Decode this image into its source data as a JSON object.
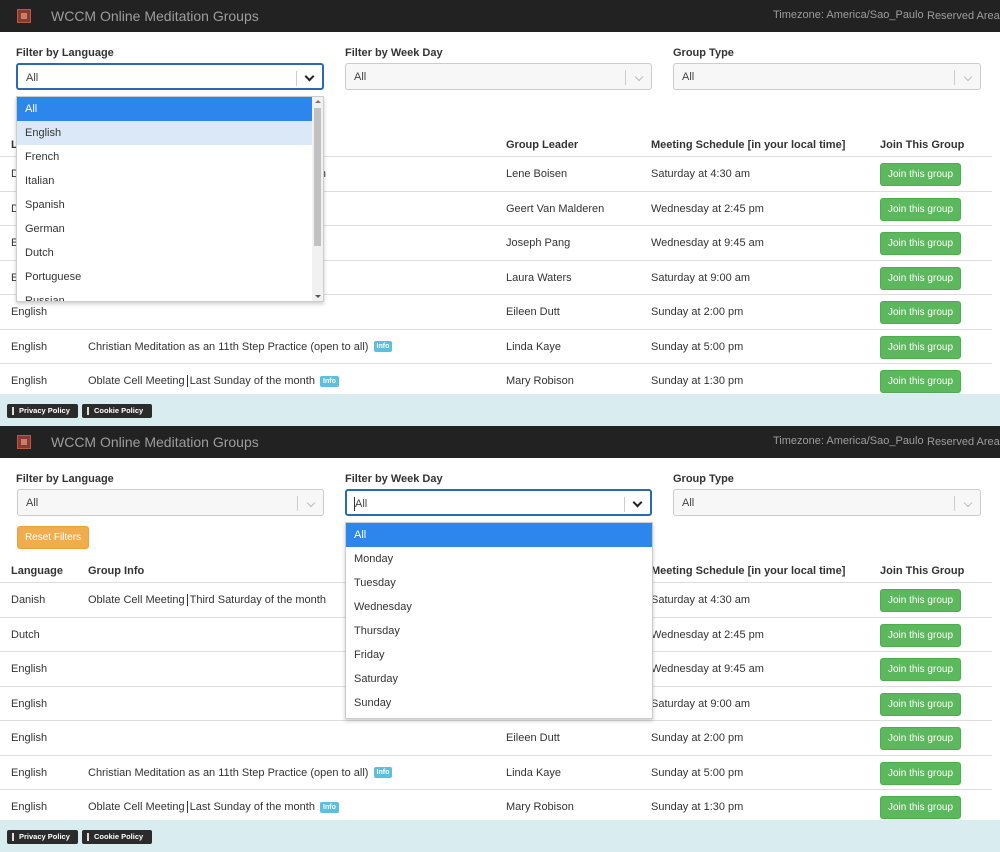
{
  "app": {
    "brand": "WCCM Online Meditation Groups",
    "timezone": "Timezone: America/Sao_Paulo",
    "reserved": "Reserved Area"
  },
  "filters": {
    "language_label": "Filter by Language",
    "weekday_label": "Filter by Week Day",
    "type_label": "Group Type",
    "language_value": "All",
    "weekday_value": "All",
    "type_value": "All",
    "reset_label": "Reset Filters"
  },
  "table": {
    "headers": {
      "language": "Language",
      "info": "Group Info",
      "leader": "Group Leader",
      "schedule": "Meeting Schedule [in your local time]",
      "join": "Join This Group"
    },
    "rows": [
      {
        "language": "Danish",
        "info": "Oblate Cell Meeting",
        "info2": "Third Saturday of the month",
        "leader": "Lene Boisen",
        "schedule": "Saturday at 4:30 am",
        "join": "Join this group"
      },
      {
        "language": "Dutch",
        "info": "",
        "info2": "",
        "leader": "Geert Van Malderen",
        "schedule": "Wednesday at 2:45 pm",
        "join": "Join this group"
      },
      {
        "language": "English",
        "info": "",
        "info2": "",
        "leader": "Joseph Pang",
        "schedule": "Wednesday at 9:45 am",
        "join": "Join this group"
      },
      {
        "language": "English",
        "info": "",
        "info2": "",
        "leader": "Laura Waters",
        "schedule": "Saturday at 9:00 am",
        "join": "Join this group"
      },
      {
        "language": "English",
        "info": "",
        "info2": "",
        "leader": "Eileen Dutt",
        "schedule": "Sunday at 2:00 pm",
        "join": "Join this group"
      },
      {
        "language": "English",
        "info": "Christian Meditation as an 11th Step Practice (open to all)",
        "info2": "",
        "badge": "Info",
        "leader": "Linda Kaye",
        "schedule": "Sunday at 5:00 pm",
        "join": "Join this group"
      },
      {
        "language": "English",
        "info": "Oblate Cell Meeting",
        "info2": "Last Sunday of the month",
        "badge": "Info",
        "leader": "Mary Robison",
        "schedule": "Sunday at 1:30 pm",
        "join": "Join this group"
      }
    ]
  },
  "language_dropdown": [
    "All",
    "English",
    "French",
    "Italian",
    "Spanish",
    "German",
    "Dutch",
    "Portuguese",
    "Russian"
  ],
  "weekday_dropdown": [
    "All",
    "Monday",
    "Tuesday",
    "Wednesday",
    "Thursday",
    "Friday",
    "Saturday",
    "Sunday"
  ],
  "footer": {
    "privacy": "Privacy Policy",
    "cookie": "Cookie Policy"
  },
  "colors": {
    "navbar": "#222222",
    "join_button": "#5cb85c",
    "reset_button": "#f0ad4e",
    "selected_option": "#2d86ec",
    "info_badge": "#5bc0de",
    "footer_bg": "#d9edf1"
  }
}
